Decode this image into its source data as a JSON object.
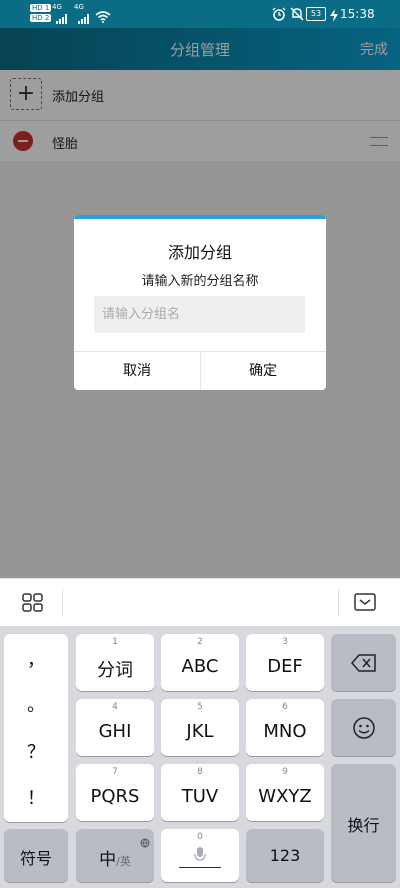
{
  "status_bar": {
    "sim1": "HD 1",
    "sim2": "HD 2",
    "network1": "4G",
    "network2": "4G",
    "battery": "53",
    "time": "15:38"
  },
  "header": {
    "title": "分组管理",
    "done_label": "完成"
  },
  "list": {
    "add_label": "添加分组",
    "groups": [
      {
        "name": "怪胎"
      }
    ]
  },
  "dialog": {
    "title": "添加分组",
    "subtitle": "请输入新的分组名称",
    "input_placeholder": "请输入分组名",
    "cancel_label": "取消",
    "confirm_label": "确定"
  },
  "keyboard": {
    "punctuation": [
      "，",
      "。",
      "？",
      "！"
    ],
    "keys": [
      {
        "num": "1",
        "label": "分词"
      },
      {
        "num": "2",
        "label": "ABC"
      },
      {
        "num": "3",
        "label": "DEF"
      },
      {
        "num": "4",
        "label": "GHI"
      },
      {
        "num": "5",
        "label": "JKL"
      },
      {
        "num": "6",
        "label": "MNO"
      },
      {
        "num": "7",
        "label": "PQRS"
      },
      {
        "num": "8",
        "label": "TUV"
      },
      {
        "num": "9",
        "label": "WXYZ"
      }
    ],
    "symbols_label": "符号",
    "chinese_label": "中",
    "english_label": "/英",
    "space_num": "0",
    "numbers_label": "123",
    "enter_label": "换行"
  },
  "colors": {
    "header_start": "#0b6c86",
    "header_end": "#0aa0d0",
    "dialog_accent": "#2aa1d9",
    "remove": "#c9352e"
  }
}
